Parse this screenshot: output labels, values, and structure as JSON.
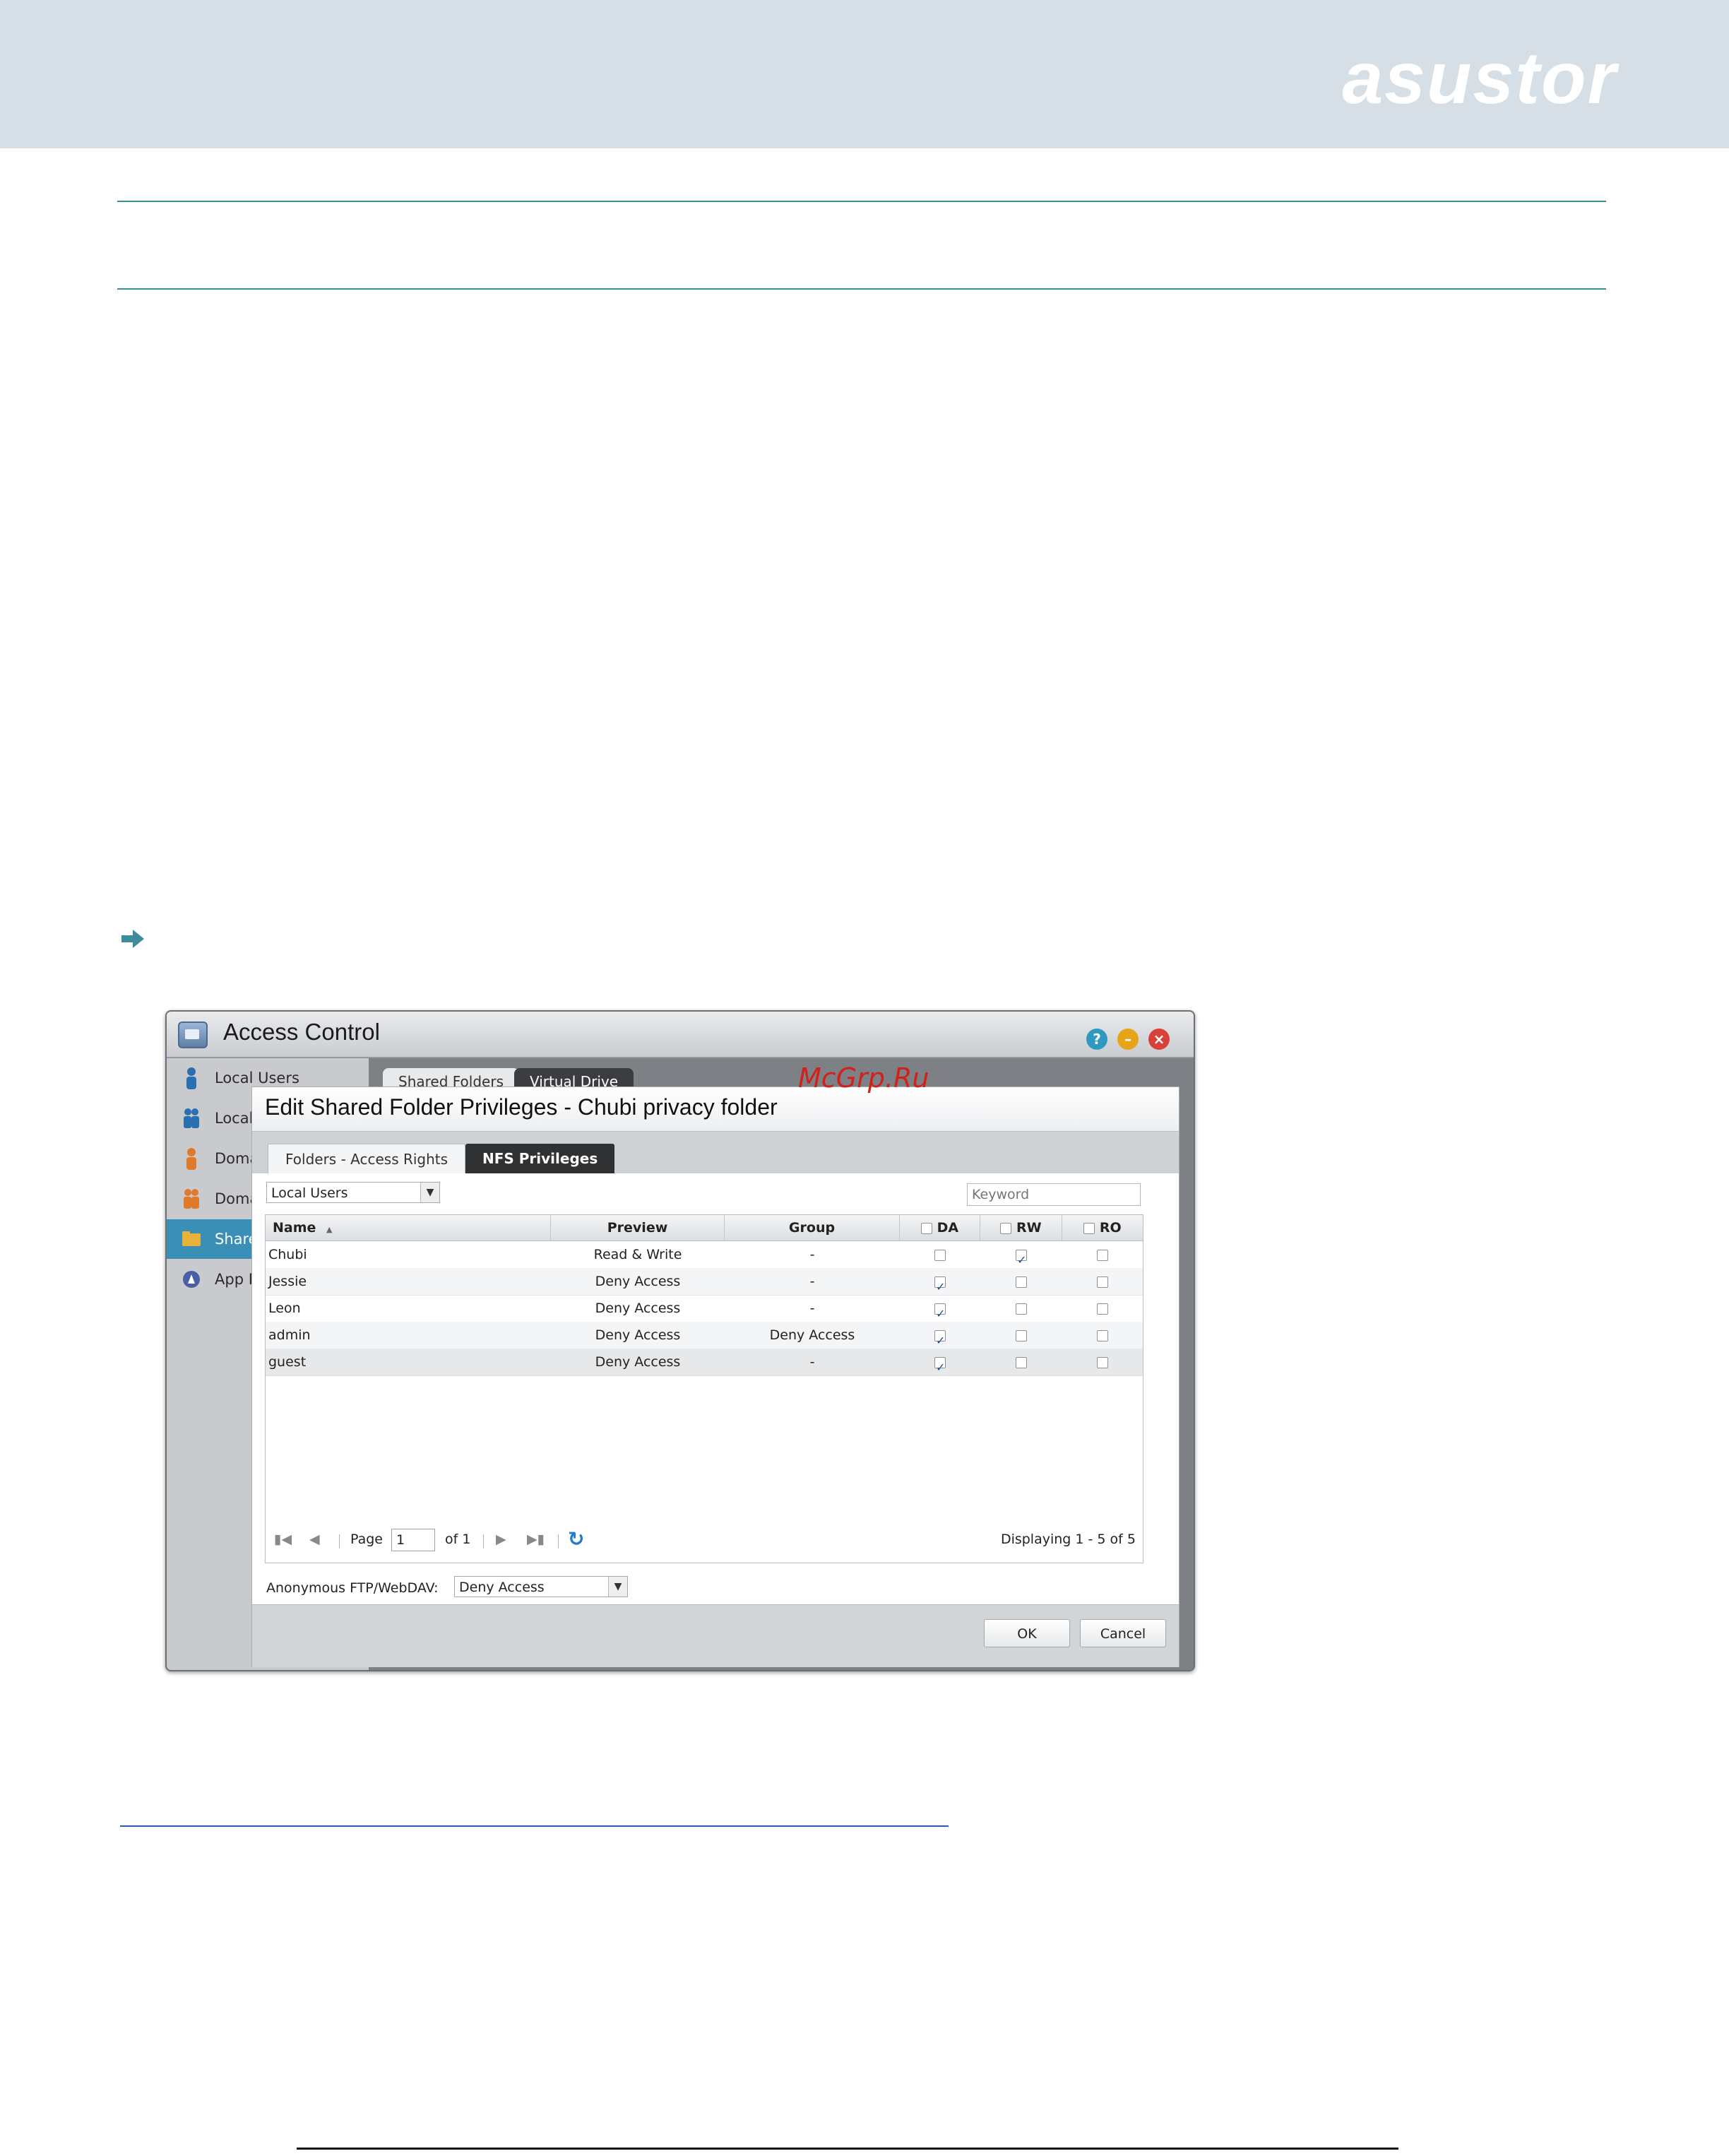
{
  "brand": {
    "logo_text": "asustor"
  },
  "window": {
    "title": "Access Control",
    "controls": {
      "help": "?",
      "minimize": "–",
      "close": "×"
    }
  },
  "sidebar": {
    "items": [
      {
        "label": "Local Users",
        "icon": "user-icon"
      },
      {
        "label": "Local",
        "icon": "users-icon"
      },
      {
        "label": "Doma",
        "icon": "user-icon"
      },
      {
        "label": "Doma",
        "icon": "users-icon"
      },
      {
        "label": "Share",
        "icon": "folder-icon"
      },
      {
        "label": "App P",
        "icon": "app-icon"
      }
    ]
  },
  "main_tabs": {
    "shared_folders": "Shared Folders",
    "virtual_drive": "Virtual Drive"
  },
  "watermark": "McGrp.Ru",
  "dialog": {
    "title": "Edit Shared Folder Privileges - Chubi privacy folder",
    "tabs": {
      "access_rights": "Folders - Access Rights",
      "nfs": "NFS Privileges"
    },
    "filter_select": "Local Users",
    "keyword_placeholder": "Keyword",
    "columns": {
      "name": "Name",
      "sort_indicator": "▲",
      "preview": "Preview",
      "group": "Group",
      "da": "DA",
      "rw": "RW",
      "ro": "RO"
    },
    "rows": [
      {
        "name": "Chubi",
        "preview": "Read & Write",
        "group": "-",
        "da": false,
        "rw": true,
        "ro": false
      },
      {
        "name": "Jessie",
        "preview": "Deny Access",
        "group": "-",
        "da": true,
        "rw": false,
        "ro": false
      },
      {
        "name": "Leon",
        "preview": "Deny Access",
        "group": "-",
        "da": true,
        "rw": false,
        "ro": false
      },
      {
        "name": "admin",
        "preview": "Deny Access",
        "group": "Deny Access",
        "da": true,
        "rw": false,
        "ro": false
      },
      {
        "name": "guest",
        "preview": "Deny Access",
        "group": "-",
        "da": true,
        "rw": false,
        "ro": false
      }
    ],
    "pager": {
      "page_label": "Page",
      "page_value": "1",
      "of_label": "of 1",
      "displaying": "Displaying 1 - 5 of 5"
    },
    "anonymous": {
      "label": "Anonymous FTP/WebDAV:",
      "value": "Deny Access"
    },
    "buttons": {
      "ok": "OK",
      "cancel": "Cancel"
    }
  },
  "colors": {
    "header_band": "#d6dfe5",
    "accent_rule": "#3e8c9a",
    "active_sidebar": "#3a8fb7",
    "watermark": "#d0221b"
  }
}
